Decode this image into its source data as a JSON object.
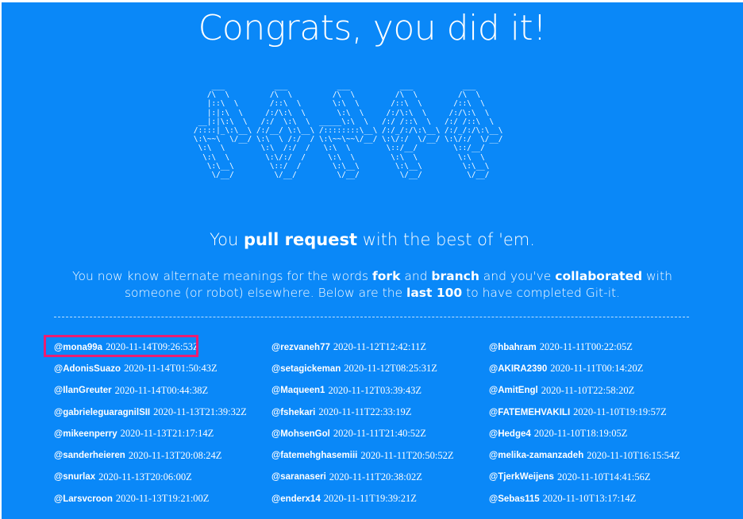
{
  "title": "Congrats, you did it!",
  "ascii_art": "       ___           ___           ___           ___           ___     \n      /\\  \\         /\\  \\         /\\  \\         /\\  \\         /\\  \\    \n      |::\\  \\       /::\\  \\       \\:\\  \\       /::\\  \\       /::\\  \\   \n      |:|:\\  \\     /:/\\:\\  \\       \\:\\  \\     /:/\\:\\  \\     /:/\\:\\  \\  \n    __|:|\\:\\  \\   /:/  \\:\\  \\  _____\\:\\  \\   /:/ /::\\  \\   /:/ /::\\  \\ \n   /::::|_\\:\\__\\ /:/__/ \\:\\__\\ /::::::::\\__\\ /:/_/:/\\:\\__\\ /:/_/:/\\:\\__\\\n   \\:\\~~\\  \\/__/ \\:\\  \\ /:/  / \\:\\~~\\~~\\/__/ \\:\\/:/  \\/__/ \\:\\/:/  \\/__/\n    \\:\\  \\        \\:\\  /:/  /   \\:\\  \\        \\::/__/        \\::/__/     \n     \\:\\  \\        \\:\\/:/  /     \\:\\  \\        \\:\\  \\         \\:\\  \\     \n      \\:\\__\\        \\::/  /       \\:\\__\\        \\:\\__\\         \\:\\__\\    \n       \\/__/         \\/__/         \\/__/         \\/__/          \\/__/    ",
  "tagline": {
    "pre": "You ",
    "bold": "pull request",
    "post": " with the best of 'em."
  },
  "description": {
    "p1": "You now know alternate meanings for the words ",
    "b1": "fork",
    "p2": " and ",
    "b2": "branch",
    "p3": " and you've ",
    "b3": "collaborated",
    "p4": " with someone (or robot) elsewhere. Below are the ",
    "b4": "last 100",
    "p5": " to have completed Git-it."
  },
  "completions": [
    {
      "user": "@mona99a",
      "time": "2020-11-14T09:26:53Z"
    },
    {
      "user": "@rezvaneh77",
      "time": "2020-11-12T12:42:11Z"
    },
    {
      "user": "@hbahram",
      "time": "2020-11-11T00:22:05Z"
    },
    {
      "user": "@AdonisSuazo",
      "time": "2020-11-14T01:50:43Z"
    },
    {
      "user": "@setagickeman",
      "time": "2020-11-12T08:25:31Z"
    },
    {
      "user": "@AKIRA2390",
      "time": "2020-11-11T00:14:20Z"
    },
    {
      "user": "@IlanGreuter",
      "time": "2020-11-14T00:44:38Z"
    },
    {
      "user": "@Maqueen1",
      "time": "2020-11-12T03:39:43Z"
    },
    {
      "user": "@AmitEngl",
      "time": "2020-11-10T22:58:20Z"
    },
    {
      "user": "@gabrieleguaragnilSII",
      "time": "2020-11-13T21:39:32Z"
    },
    {
      "user": "@fshekari",
      "time": "2020-11-11T22:33:19Z"
    },
    {
      "user": "@FATEMEHVAKILI",
      "time": "2020-11-10T19:19:57Z"
    },
    {
      "user": "@mikeenperry",
      "time": "2020-11-13T21:17:14Z"
    },
    {
      "user": "@MohsenGol",
      "time": "2020-11-11T21:40:52Z"
    },
    {
      "user": "@Hedge4",
      "time": "2020-11-10T18:19:05Z"
    },
    {
      "user": "@sanderheieren",
      "time": "2020-11-13T20:08:24Z"
    },
    {
      "user": "@fatemehghasemiii",
      "time": "2020-11-11T20:50:52Z"
    },
    {
      "user": "@melika-zamanzadeh",
      "time": "2020-11-10T16:15:54Z"
    },
    {
      "user": "@snurlax",
      "time": "2020-11-13T20:06:00Z"
    },
    {
      "user": "@saranaseri",
      "time": "2020-11-11T20:38:02Z"
    },
    {
      "user": "@TjerkWeijens",
      "time": "2020-11-10T14:41:56Z"
    },
    {
      "user": "@Larsvcroon",
      "time": "2020-11-13T19:21:00Z"
    },
    {
      "user": "@enderx14",
      "time": "2020-11-11T19:39:21Z"
    },
    {
      "user": "@Sebas115",
      "time": "2020-11-10T13:17:14Z"
    }
  ],
  "highlight_color": "#ea1e72",
  "background_color": "#0a88f8"
}
